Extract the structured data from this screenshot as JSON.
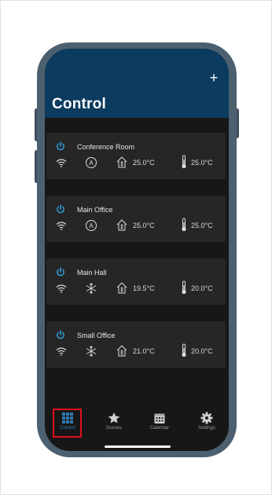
{
  "header": {
    "title": "Control",
    "add_label": "+"
  },
  "rooms": [
    {
      "name": "Conference Room",
      "mode": "auto",
      "indoor_temp": "25.0°C",
      "setpoint": "25.0°C"
    },
    {
      "name": "Main Office",
      "mode": "auto",
      "indoor_temp": "25.0°C",
      "setpoint": "25.0°C"
    },
    {
      "name": "Main Hall",
      "mode": "cool",
      "indoor_temp": "19.5°C",
      "setpoint": "20.0°C"
    },
    {
      "name": "Small Office",
      "mode": "cool",
      "indoor_temp": "21.0°C",
      "setpoint": "20.0°C"
    }
  ],
  "tabs": [
    {
      "label": "Control",
      "icon": "grid-icon",
      "active": true
    },
    {
      "label": "Scenes",
      "icon": "star-icon",
      "active": false
    },
    {
      "label": "Calendar",
      "icon": "calendar-icon",
      "active": false
    },
    {
      "label": "Settings",
      "icon": "gear-icon",
      "active": false
    }
  ],
  "colors": {
    "header": "#0b3b5e",
    "accent": "#2e9bd6",
    "card": "#262626",
    "highlight": "#e0101e"
  }
}
